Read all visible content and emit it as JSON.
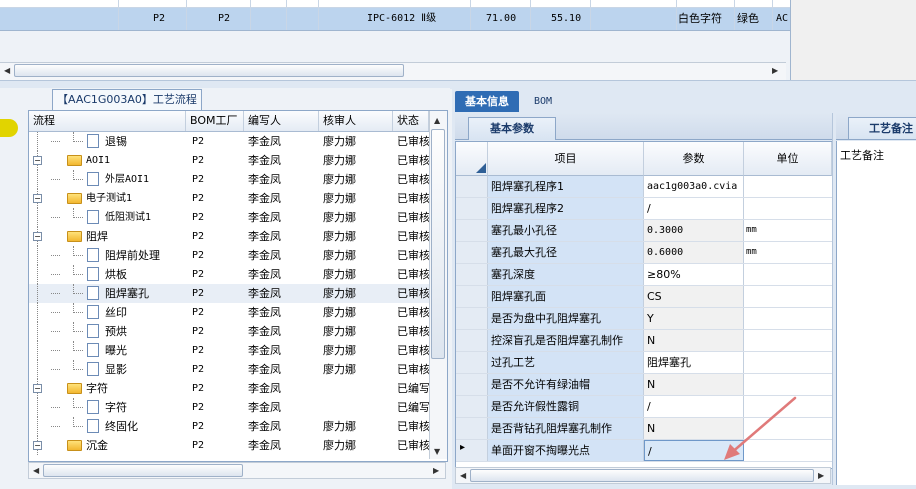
{
  "top_grid": {
    "row": {
      "col1": "P2",
      "col2": "P2",
      "model": "IPC-6012 Ⅱ级",
      "val1": "71.00",
      "val2": "55.10",
      "char_color": "白色字符",
      "mask_color": "绿色",
      "last": "AC"
    }
  },
  "left_panel": {
    "tab_title": "【AAC1G003A0】工艺流程",
    "columns": [
      "流程",
      "BOM工厂",
      "编写人",
      "核审人",
      "状态"
    ],
    "rows": [
      {
        "label": "退锡",
        "level": 2,
        "type": "doc",
        "bom": "P2",
        "writer": "李金凤",
        "reviewer": "廖力娜",
        "status": "已审核"
      },
      {
        "label": "AOI1",
        "level": 1,
        "type": "folder",
        "bom": "P2",
        "writer": "李金凤",
        "reviewer": "廖力娜",
        "status": "已审核"
      },
      {
        "label": "外层AOI1",
        "level": 2,
        "type": "doc",
        "bom": "P2",
        "writer": "李金凤",
        "reviewer": "廖力娜",
        "status": "已审核"
      },
      {
        "label": "电子测试1",
        "level": 1,
        "type": "folder",
        "bom": "P2",
        "writer": "李金凤",
        "reviewer": "廖力娜",
        "status": "已审核"
      },
      {
        "label": "低阻测试1",
        "level": 2,
        "type": "doc",
        "bom": "P2",
        "writer": "李金凤",
        "reviewer": "廖力娜",
        "status": "已审核"
      },
      {
        "label": "阻焊",
        "level": 1,
        "type": "folder",
        "bom": "P2",
        "writer": "李金凤",
        "reviewer": "廖力娜",
        "status": "已审核"
      },
      {
        "label": "阻焊前处理",
        "level": 2,
        "type": "doc",
        "bom": "P2",
        "writer": "李金凤",
        "reviewer": "廖力娜",
        "status": "已审核"
      },
      {
        "label": "烘板",
        "level": 2,
        "type": "doc",
        "bom": "P2",
        "writer": "李金凤",
        "reviewer": "廖力娜",
        "status": "已审核"
      },
      {
        "label": "阻焊塞孔",
        "level": 2,
        "type": "doc",
        "bom": "P2",
        "writer": "李金凤",
        "reviewer": "廖力娜",
        "status": "已审核",
        "selected": true
      },
      {
        "label": "丝印",
        "level": 2,
        "type": "doc",
        "bom": "P2",
        "writer": "李金凤",
        "reviewer": "廖力娜",
        "status": "已审核"
      },
      {
        "label": "预烘",
        "level": 2,
        "type": "doc",
        "bom": "P2",
        "writer": "李金凤",
        "reviewer": "廖力娜",
        "status": "已审核"
      },
      {
        "label": "曝光",
        "level": 2,
        "type": "doc",
        "bom": "P2",
        "writer": "李金凤",
        "reviewer": "廖力娜",
        "status": "已审核"
      },
      {
        "label": "显影",
        "level": 2,
        "type": "doc",
        "bom": "P2",
        "writer": "李金凤",
        "reviewer": "廖力娜",
        "status": "已审核"
      },
      {
        "label": "字符",
        "level": 1,
        "type": "folder",
        "bom": "P2",
        "writer": "李金凤",
        "reviewer": "",
        "status": "已编写"
      },
      {
        "label": "字符",
        "level": 2,
        "type": "doc",
        "bom": "P2",
        "writer": "李金凤",
        "reviewer": "",
        "status": "已编写"
      },
      {
        "label": "终固化",
        "level": 2,
        "type": "doc",
        "bom": "P2",
        "writer": "李金凤",
        "reviewer": "廖力娜",
        "status": "已审核"
      },
      {
        "label": "沉金",
        "level": 1,
        "type": "folder",
        "bom": "P2",
        "writer": "李金凤",
        "reviewer": "廖力娜",
        "status": "已审核"
      }
    ]
  },
  "right_panel": {
    "tabs": [
      "基本信息",
      "BOM"
    ],
    "sub_tab": "基本参数",
    "columns": [
      "项目",
      "参数",
      "单位"
    ],
    "rows": [
      {
        "item": "阻焊塞孔程序1",
        "value": "aac1g003a0.cvia",
        "unit": "",
        "mono": true
      },
      {
        "item": "阻焊塞孔程序2",
        "value": "/",
        "unit": ""
      },
      {
        "item": "塞孔最小孔径",
        "value": "0.3000",
        "unit": "mm",
        "mono": true,
        "gray": true
      },
      {
        "item": "塞孔最大孔径",
        "value": "0.6000",
        "unit": "mm",
        "mono": true,
        "gray": true
      },
      {
        "item": "塞孔深度",
        "value": "≥80%",
        "unit": ""
      },
      {
        "item": "阻焊塞孔面",
        "value": "CS",
        "unit": "",
        "gray": true
      },
      {
        "item": "是否为盘中孔阻焊塞孔",
        "value": "Y",
        "unit": "",
        "gray": true
      },
      {
        "item": "控深盲孔是否阻焊塞孔制作",
        "value": "N",
        "unit": "",
        "gray": true
      },
      {
        "item": "过孔工艺",
        "value": "阻焊塞孔",
        "unit": ""
      },
      {
        "item": "是否不允许有绿油帽",
        "value": "N",
        "unit": "",
        "gray": true
      },
      {
        "item": "是否允许假性露铜",
        "value": "/",
        "unit": ""
      },
      {
        "item": "是否背钻孔阻焊塞孔制作",
        "value": "N",
        "unit": "",
        "gray": true
      },
      {
        "item": "单面开窗不掏曝光点",
        "value": "/",
        "unit": "",
        "editing": true
      }
    ],
    "craft_tab": "工艺备注",
    "craft_label": "工艺备注"
  }
}
